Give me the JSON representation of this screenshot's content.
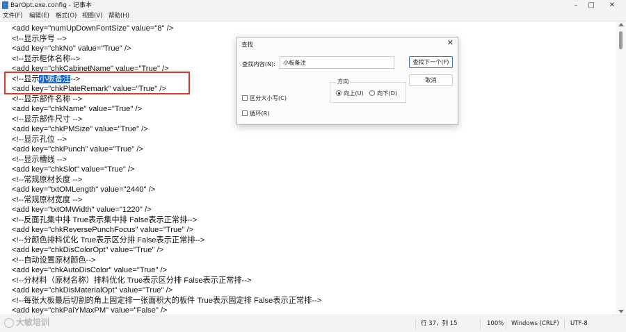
{
  "window": {
    "title": "BarOpt.exe.config - 记事本",
    "minimize": "–",
    "maximize": "□",
    "close": "✕"
  },
  "menu": [
    "文件(F)",
    "编辑(E)",
    "格式(O)",
    "视图(V)",
    "帮助(H)"
  ],
  "editor": {
    "lines": [
      {
        "text": "<add key=\"numUpDownFontSize\" value=\"8\" />"
      },
      {
        "text": "<!--显示序号 -->"
      },
      {
        "text": "<add key=\"chkNo\" value=\"True\" />"
      },
      {
        "text": "<!--显示柜体名称-->"
      },
      {
        "text": "<add key=\"chkCabinetName\" value=\"True\" />"
      },
      {
        "text": "<!--显示",
        "highlight": "小板备注",
        "after": "-->"
      },
      {
        "text": "<add key=\"chkPlateRemark\" value=\"True\" />"
      },
      {
        "text": "<!--显示部件名称 -->"
      },
      {
        "text": "<add key=\"chkName\" value=\"True\" />"
      },
      {
        "text": "<!--显示部件尺寸 -->"
      },
      {
        "text": "<add key=\"chkPMSize\" value=\"True\" />"
      },
      {
        "text": "<!--显示孔位 -->"
      },
      {
        "text": "<add key=\"chkPunch\" value=\"True\" />"
      },
      {
        "text": "<!--显示槽线 -->"
      },
      {
        "text": "<add key=\"chkSlot\" value=\"True\" />"
      },
      {
        "text": "<!--常规原材长度 -->"
      },
      {
        "text": "<add key=\"txtOMLength\" value=\"2440\" />"
      },
      {
        "text": "<!--常规原材宽度 -->"
      },
      {
        "text": "<add key=\"txtOMWidth\" value=\"1220\" />"
      },
      {
        "text": "<!--反面孔集中排 True表示集中排 False表示正常排-->"
      },
      {
        "text": "<add key=\"chkReversePunchFocus\" value=\"True\" />"
      },
      {
        "text": "<!--分颜色排料优化 True表示区分排 False表示正常排-->"
      },
      {
        "text": "<add key=\"chkDisColorOpt\" value=\"True\" />"
      },
      {
        "text": "<!--自动设置原材颜色-->"
      },
      {
        "text": "<add key=\"chkAutoDisColor\" value=\"True\" />"
      },
      {
        "text": "<!--分材料（原材名称）排料优化 True表示区分排 False表示正常排-->"
      },
      {
        "text": "<add key=\"chkDisMaterialOpt\" value=\"True\" />"
      },
      {
        "text": "<!--每张大板最后切割的角上固定排一张面积大的板件 True表示固定排 False表示正常排-->"
      },
      {
        "text": "<add key=\"chkPaiYMaxPM\" value=\"False\" />"
      }
    ]
  },
  "find_dialog": {
    "title": "查找",
    "close": "✕",
    "find_label": "查找内容(N):",
    "find_value": "小板备注",
    "find_next": "查找下一个(F)",
    "cancel": "取消",
    "direction_label": "方向",
    "up": "向上(U)",
    "down": "向下(D)",
    "direction_selected": "up",
    "match_case": "区分大小写(C)",
    "wrap": "循环(R)"
  },
  "status": {
    "position": "行 37，列 15",
    "zoom": "100%",
    "line_ending": "Windows (CRLF)",
    "encoding": "UTF-8"
  },
  "watermark": "大敏培训"
}
